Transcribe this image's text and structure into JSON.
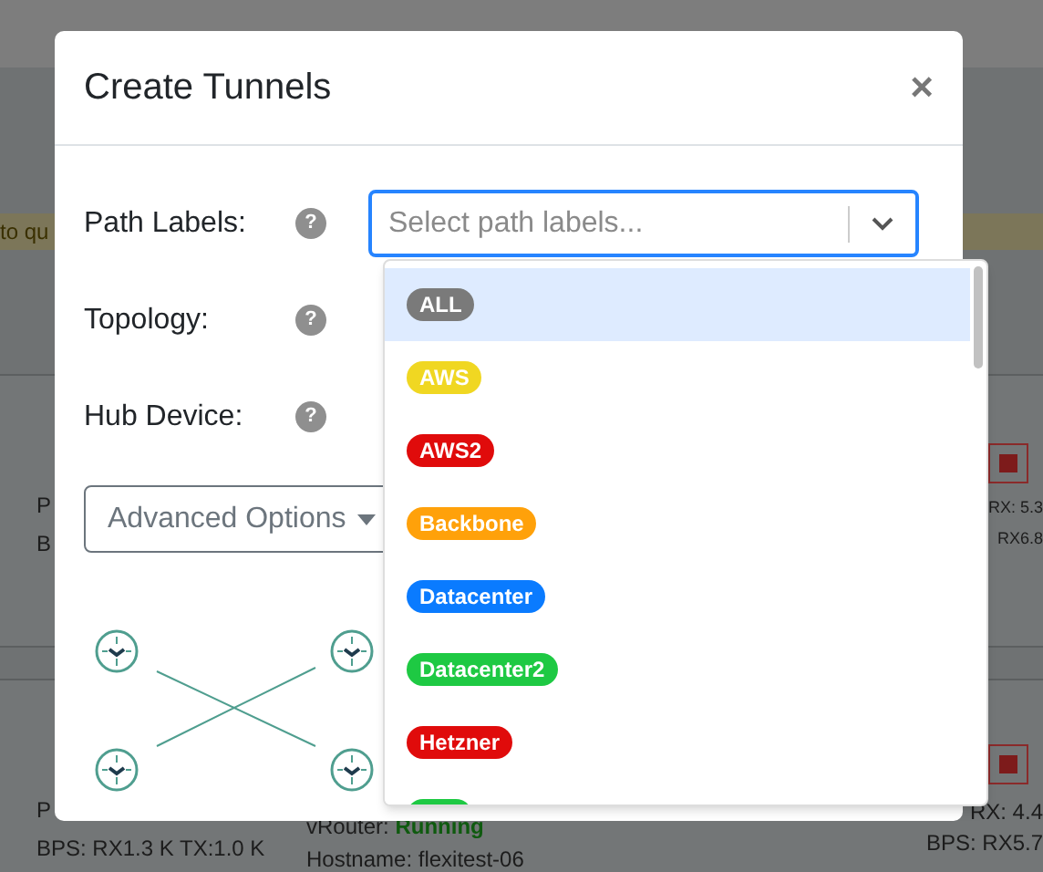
{
  "background": {
    "banner_text": "to qu",
    "left_top": [
      "P",
      "B"
    ],
    "left_bottom": [
      "P",
      "BPS: RX1.3 K TX:1.0 K"
    ],
    "middle_bottom": {
      "label": "vRouter:",
      "status": "Running",
      "hostname": "Hostname: flexitest-06"
    },
    "right_top": [
      "RX: 5.3",
      "RX6.8"
    ],
    "right_bottom": [
      "RX: 4.4",
      "BPS: RX5.7"
    ]
  },
  "modal": {
    "title": "Create Tunnels",
    "close": "×",
    "fields": [
      {
        "label": "Path Labels:",
        "kind": "select",
        "help": "?"
      },
      {
        "label": "Topology:",
        "kind": "plain",
        "help": "?"
      },
      {
        "label": "Hub Device:",
        "kind": "plain",
        "help": "?"
      }
    ],
    "select": {
      "placeholder": "Select path labels...",
      "expanded": true
    },
    "advanced": {
      "label": "Advanced Options"
    },
    "options": [
      {
        "label": "ALL",
        "color": "#7a7a7a",
        "selected": true
      },
      {
        "label": "AWS",
        "color": "#f0d722",
        "selected": false
      },
      {
        "label": "AWS2",
        "color": "#e00b0b",
        "selected": false
      },
      {
        "label": "Backbone",
        "color": "#ffa10a",
        "selected": false
      },
      {
        "label": "Datacenter",
        "color": "#0a7bff",
        "selected": false
      },
      {
        "label": "Datacenter2",
        "color": "#1ec943",
        "selected": false
      },
      {
        "label": "Hetzner",
        "color": "#e00b0b",
        "selected": false
      },
      {
        "color": "#1ec943",
        "selected": false
      }
    ]
  }
}
